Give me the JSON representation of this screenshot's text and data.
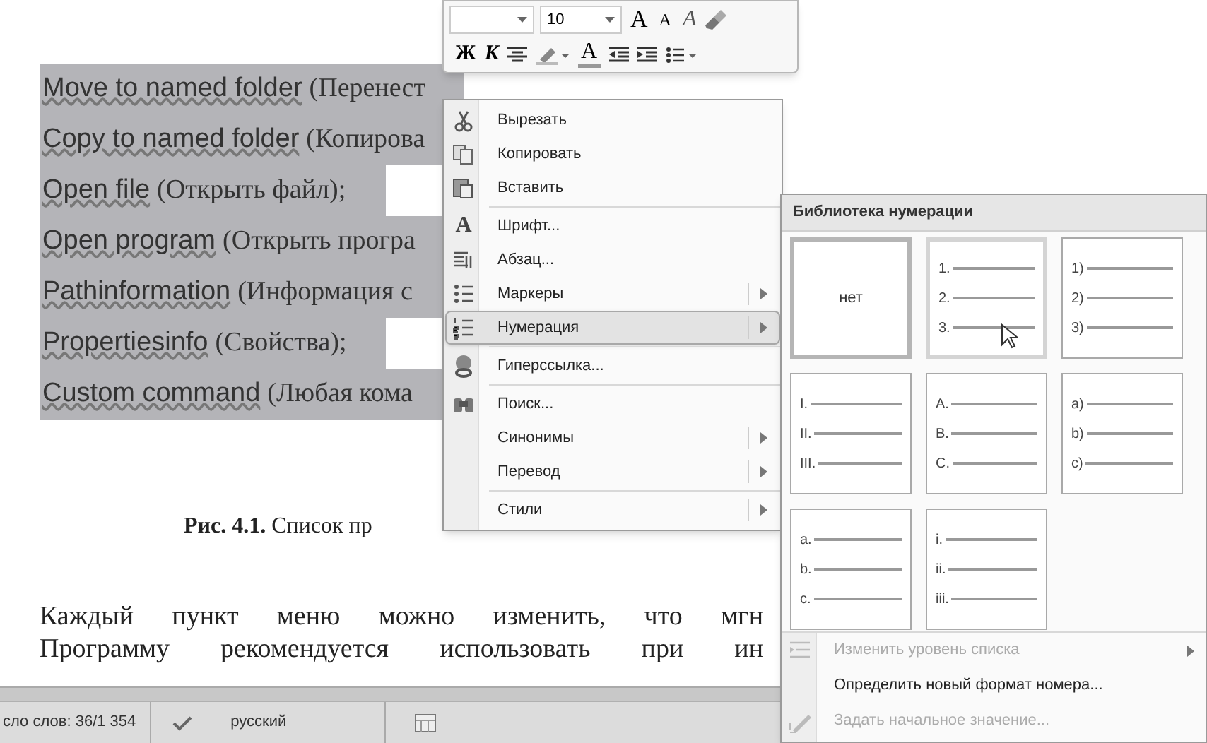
{
  "document": {
    "selected_lines": [
      {
        "en": "Move to named folder",
        "ru": "(Перенест",
        "extends": true
      },
      {
        "en": "Copy to named folder",
        "ru": "(Копирова",
        "extends": true
      },
      {
        "en": "Open file",
        "ru": "(Открыть файл);",
        "extends": false
      },
      {
        "en": "Open program",
        "ru": "(Открыть програ",
        "extends": true
      },
      {
        "en": "Pathinformation",
        "ru": "(Информация с",
        "extends": true
      },
      {
        "en": "Propertiesinfo",
        "ru": "(Свойства);",
        "extends": false
      },
      {
        "en": "Custom command",
        "ru": "(Любая кома",
        "extends": true
      }
    ],
    "caption": "**Рис. 4.1.** Список пр",
    "paragraph": [
      "Каждый пункт меню можно изменить, что мгн",
      "Программу рекомендуется использовать при ин"
    ]
  },
  "mini_toolbar": {
    "font_size": "10",
    "grow_font": "A",
    "shrink_font": "A",
    "clear_format": "A",
    "bold": "Ж",
    "italic": "К",
    "font_color": "A"
  },
  "context_menu": [
    {
      "kind": "scissors",
      "label": "Вырезать",
      "submenu": false,
      "selected": false
    },
    {
      "kind": "copy",
      "label": "Копировать",
      "submenu": false,
      "selected": false
    },
    {
      "kind": "paste",
      "label": "Вставить",
      "submenu": false,
      "selected": false
    },
    {
      "kind": "separator"
    },
    {
      "kind": "font",
      "glyph": "A",
      "label": "Шрифт...",
      "submenu": false,
      "selected": false
    },
    {
      "kind": "paragraph",
      "label": "Абзац...",
      "submenu": false,
      "selected": false
    },
    {
      "kind": "bullets",
      "label": "Маркеры",
      "submenu": true,
      "selected": false
    },
    {
      "kind": "numbering",
      "label": "Нумерация",
      "submenu": true,
      "selected": true
    },
    {
      "kind": "separator"
    },
    {
      "kind": "link",
      "label": "Гиперссылка...",
      "submenu": false,
      "selected": false
    },
    {
      "kind": "separator"
    },
    {
      "kind": "search",
      "label": "Поиск...",
      "submenu": false,
      "selected": false
    },
    {
      "kind": "plain",
      "label": "Синонимы",
      "submenu": true,
      "selected": false
    },
    {
      "kind": "plain",
      "label": "Перевод",
      "submenu": true,
      "selected": false
    },
    {
      "kind": "separator"
    },
    {
      "kind": "plain",
      "label": "Стили",
      "submenu": true,
      "selected": false
    }
  ],
  "numbering_library": {
    "title": "Библиотека нумерации",
    "formats": [
      {
        "kind": "none",
        "label": "нет",
        "selected": true,
        "hovered": false
      },
      {
        "kind": "list",
        "markers": [
          "1.",
          "2.",
          "3."
        ],
        "selected": false,
        "hovered": true
      },
      {
        "kind": "list",
        "markers": [
          "1)",
          "2)",
          "3)"
        ],
        "selected": false,
        "hovered": false
      },
      {
        "kind": "list",
        "markers": [
          "I.",
          "II.",
          "III."
        ],
        "selected": false,
        "hovered": false
      },
      {
        "kind": "list",
        "markers": [
          "A.",
          "B.",
          "C."
        ],
        "selected": false,
        "hovered": false
      },
      {
        "kind": "list",
        "markers": [
          "a)",
          "b)",
          "c)"
        ],
        "selected": false,
        "hovered": false
      },
      {
        "kind": "list",
        "markers": [
          "a.",
          "b.",
          "c."
        ],
        "selected": false,
        "hovered": false
      },
      {
        "kind": "list",
        "markers": [
          "i.",
          "ii.",
          "iii."
        ],
        "selected": false,
        "hovered": false
      }
    ],
    "commands": [
      {
        "kind": "level",
        "label": "Изменить уровень списка",
        "disabled": true,
        "submenu": true
      },
      {
        "kind": "plain",
        "label": "Определить новый формат номера...",
        "disabled": false,
        "submenu": false
      },
      {
        "kind": "start",
        "label": "Задать начальное значение...",
        "disabled": true,
        "submenu": false
      }
    ]
  },
  "status_bar": {
    "word_count": "сло слов: 36/1 354",
    "language": "русский"
  }
}
